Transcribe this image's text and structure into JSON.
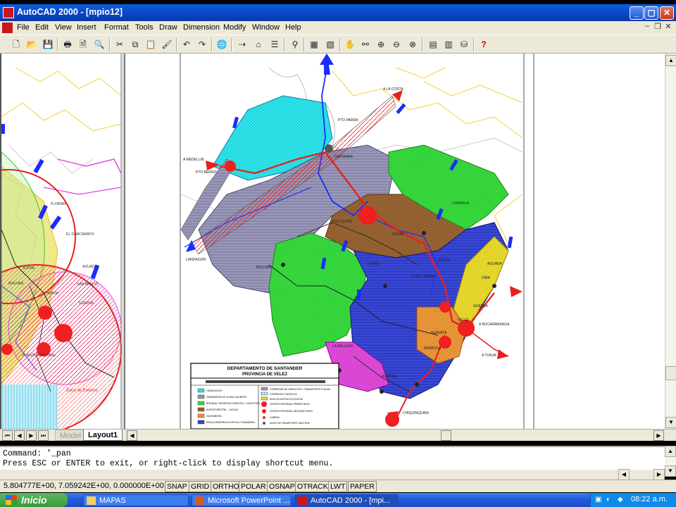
{
  "window": {
    "title": "AutoCAD 2000 - [mpio12]",
    "buttons": [
      "_",
      "▢",
      "✕"
    ]
  },
  "menu": {
    "items": [
      "File",
      "Edit",
      "View",
      "Insert",
      "Format",
      "Tools",
      "Draw",
      "Dimension",
      "Modify",
      "Window",
      "Help"
    ]
  },
  "drawing": {
    "labels": {
      "la_costa": "A LA COSTA",
      "pto_parra": "PTO PARRA",
      "medellin": "A MEDELLIN",
      "pto_berrio": "PTO BERRIO",
      "cimitarra": "CIMITARRA",
      "bolivar": "BOLIVAR",
      "landazuri": "LANDAZURI",
      "la_belleza": "LA BELLEZA",
      "albania": "ALBANIA",
      "chiquinquira": "CHIQUINQUIRA",
      "bucaramanga": "A BUCARAMANGA",
      "tunja": "A TUNJA",
      "vélez": "VELEZ",
      "barbosa": "BARBOSA",
      "guavata": "GUAVATA",
      "puente_nacional": "PUENTE NACIONAL",
      "jesus_maria": "JESUS MARIA",
      "sucre": "SUCRE",
      "florian": "FLORIAN",
      "el_guacamayo": "EL GUACAMAYO",
      "la_aguada": "AGUADA",
      "chipata": "CHIPATA",
      "guepsa": "GUEPSA",
      "san_benito": "SAN BENITO",
      "bolivar_left": "BOLIVAR",
      "sucre_left": "SUCRE",
      "zona_entorno": "Zona de Entorno",
      "sanpedro": "PTO OLAYA",
      "oiba": "OIBA",
      "suaita": "SUAITA",
      "charala": "CHARALA",
      "la_paz": "LA PAZ"
    },
    "legend": {
      "title": "DEPARTAMENTO DE SANTANDER",
      "subtitle": "PROVINCIA DE VELEZ",
      "left_items": [
        "HUMEDALES",
        "GANADERIA DE CLIMA CALIENTE",
        "BOSQUE, RESERVA FORESTAL / CAFETERO",
        "AGROFORESTAL - CACAO",
        "GUAYABERA",
        "PESCA RESERVA ECOFICA / PANADERA"
      ],
      "right_items": [
        "CORREDOR DE SERVICIOS Y TRANSPORTE FLUVIAL",
        "CORREDOR TURISTICO",
        "SUELOS AGROECOLOGICOS",
        "CENTRO REGIONAL PRIMER NIVEL",
        "CENTRO REGIONAL SEGUNDO NIVEL",
        "CABERA",
        "NODO DE TRANSPORTE MULTIPLE"
      ]
    }
  },
  "tabs": {
    "model": "Model",
    "layout": "Layout1"
  },
  "command": {
    "line1": "Command: '_pan",
    "line2": "Press ESC or ENTER to exit, or right-click to display shortcut menu."
  },
  "status": {
    "coords": "5.804777E+00, 7.059242E+00, 0.000000E+00",
    "toggles": [
      "SNAP",
      "GRID",
      "ORTHO",
      "POLAR",
      "OSNAP",
      "OTRACK",
      "LWT",
      "PAPER"
    ]
  },
  "taskbar": {
    "start": "Inicio",
    "tasks": [
      "MAPAS",
      "Microsoft PowerPoint ...",
      "AutoCAD 2000 - [mpi..."
    ],
    "clock": "08:22 a.m."
  },
  "colors": {
    "titlebar": "#0a47c4",
    "chrome": "#ece9d8",
    "taskbar": "#245edc"
  }
}
